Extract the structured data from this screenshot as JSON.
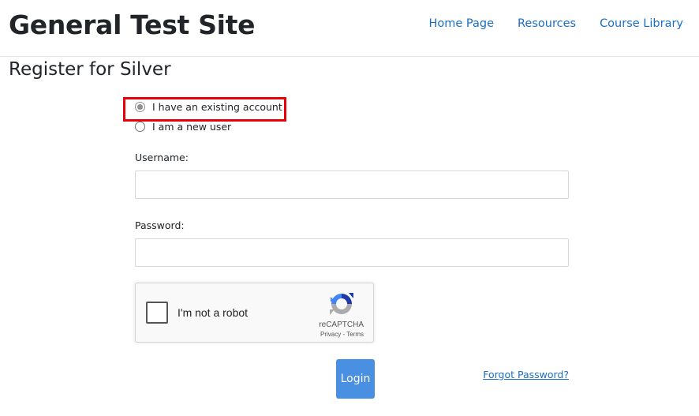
{
  "header": {
    "site_title": "General Test Site",
    "nav": [
      {
        "label": "Home Page"
      },
      {
        "label": "Resources"
      },
      {
        "label": "Course Library"
      }
    ]
  },
  "page": {
    "title": "Register for Silver"
  },
  "form": {
    "account_options": [
      {
        "label": "I have an existing account",
        "checked": true,
        "highlighted": true
      },
      {
        "label": "I am a new user",
        "checked": false
      }
    ],
    "username": {
      "label": "Username:",
      "value": "",
      "placeholder": ""
    },
    "password": {
      "label": "Password:",
      "value": "",
      "placeholder": ""
    },
    "recaptcha": {
      "checkbox_label": "I'm not a robot",
      "brand": "reCAPTCHA",
      "privacy": "Privacy",
      "separator": " - ",
      "terms": "Terms",
      "checked": false
    },
    "login_label": "Login",
    "forgot_password_label": "Forgot Password?"
  },
  "colors": {
    "link": "#1b6ec2",
    "button": "#4a90e2",
    "highlight": "#e8000b"
  }
}
